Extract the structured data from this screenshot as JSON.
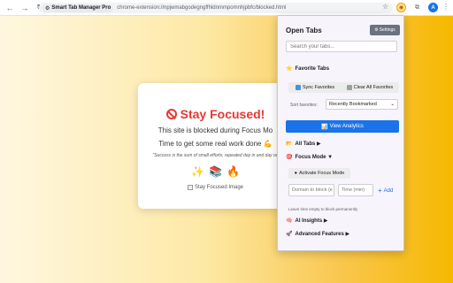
{
  "browser": {
    "site_chip": "Smart Tab Manager Pro",
    "url": "chrome-extension://npjwmabgodegngffhldnmmpomnhjpbfc/blocked.html",
    "profile_initial": "A"
  },
  "blocked_page": {
    "title": "Stay Focused!",
    "line1": "This site is blocked during Focus Mo",
    "line2": "Time to get some real work done 💪",
    "quote": "\"Success is the sum of small efforts, repeated day in and day ou",
    "emojis": [
      "✨",
      "📚",
      "🔥"
    ],
    "image_alt": "Stay Focused Image"
  },
  "popup": {
    "title": "Open Tabs",
    "settings_label": "Settings",
    "search_placeholder": "Search your tabs...",
    "favorites": {
      "heading": "Favorite Tabs",
      "sync_label": "Sync Favorites",
      "clear_label": "Clear All Favorites",
      "sort_label": "Sort favorites:",
      "sort_value": "Recently Bookmarked"
    },
    "analytics_label": "View Analytics",
    "all_tabs_label": "All Tabs ▶",
    "focus_mode": {
      "heading": "Focus Mode ▼",
      "activate_label": "Activate Focus Mode",
      "domain_placeholder": "Domain to block (e",
      "time_placeholder": "Time (min)",
      "add_label": "Add",
      "hint": "Leave time empty to block permanently"
    },
    "ai_insights_label": "AI Insights ▶",
    "advanced_label": "Advanced Features ▶"
  },
  "colors": {
    "accent_blue": "#1a73e8",
    "title_red": "#e53935",
    "page_yellow": "#f6b800"
  }
}
